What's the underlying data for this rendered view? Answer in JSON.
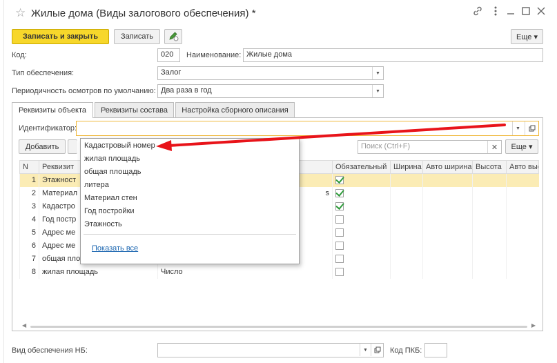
{
  "window": {
    "title": "Жилые дома (Виды залогового обеспечения) *"
  },
  "toolbar": {
    "save_close_label": "Записать и закрыть",
    "save_label": "Записать",
    "more_label": "Еще ▾"
  },
  "fields": {
    "code_label": "Код:",
    "code_value": "020",
    "name_label": "Наименование:",
    "name_value": "Жилые дома",
    "type_label": "Тип обеспечения:",
    "type_value": "Залог",
    "period_label": "Периодичность осмотров по умолчанию:",
    "period_value": "Два раза в год",
    "identifier_label": "Идентификатор:",
    "identifier_value": "",
    "nb_label": "Вид обеспечения НБ:",
    "nb_value": "",
    "pkb_label": "Код ПКБ:",
    "pkb_value": ""
  },
  "tabs": [
    {
      "label": "Реквизиты объекта",
      "active": true
    },
    {
      "label": "Реквизиты состава",
      "active": false
    },
    {
      "label": "Настройка сборного описания",
      "active": false
    }
  ],
  "table_toolbar": {
    "add_label": "Добавить",
    "search_placeholder": "Поиск (Ctrl+F)",
    "more_label": "Еще ▾"
  },
  "table": {
    "columns": [
      "N",
      "Реквизит",
      "",
      "Обязательный",
      "Ширина",
      "Авто ширина",
      "Высота",
      "Авто высота"
    ],
    "rows": [
      {
        "n": "1",
        "name": "Этажност",
        "type": "",
        "required": true,
        "selected": true
      },
      {
        "n": "2",
        "name": "Материал",
        "type": "s",
        "required": true,
        "selected": false
      },
      {
        "n": "3",
        "name": "Кадастро",
        "type": "",
        "required": true,
        "selected": false
      },
      {
        "n": "4",
        "name": "Год постр",
        "type": "",
        "required": false,
        "selected": false
      },
      {
        "n": "5",
        "name": "Адрес ме",
        "type": "",
        "required": false,
        "selected": false
      },
      {
        "n": "6",
        "name": "Адрес ме",
        "type": "",
        "required": false,
        "selected": false
      },
      {
        "n": "7",
        "name": "общая пло",
        "type": "",
        "required": false,
        "selected": false
      },
      {
        "n": "8",
        "name": "жилая площадь",
        "type": "Число",
        "required": false,
        "selected": false
      }
    ]
  },
  "dropdown": {
    "items": [
      "Кадастровый номер",
      "жилая площадь",
      "общая площадь",
      "литера",
      "Материал стен",
      "Год постройки",
      "Этажность"
    ],
    "show_all_label": "Показать все"
  },
  "colors": {
    "primary_button": "#f7d72b",
    "selected_row": "#fbecb5",
    "identifier_border": "#f0b83a",
    "arrow": "#e8141a",
    "checkbox_check": "#2e9a3a"
  }
}
